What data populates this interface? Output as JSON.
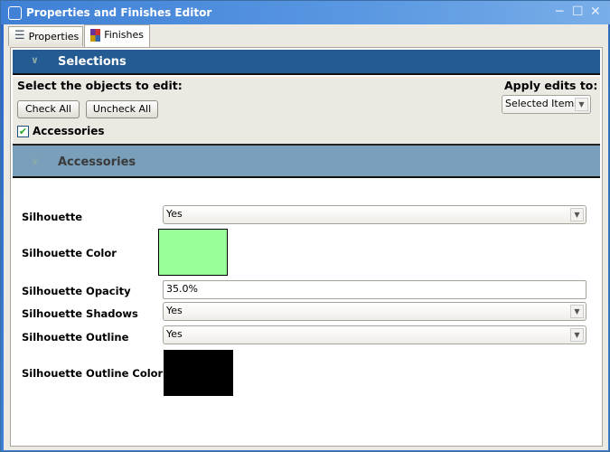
{
  "window": {
    "title": "Properties and Finishes Editor"
  },
  "tabs": [
    {
      "label": "Properties",
      "icon": "list-icon"
    },
    {
      "label": "Finishes",
      "icon": "color-grid-icon",
      "active": true
    }
  ],
  "selections": {
    "header": "Selections",
    "prompt": "Select the objects to edit:",
    "check_all": "Check All",
    "uncheck_all": "Uncheck All",
    "apply_label": "Apply edits to:",
    "apply_value": "Selected Items",
    "items": [
      {
        "label": "Accessories",
        "checked": true
      }
    ]
  },
  "accessories": {
    "header": "Accessories",
    "properties": {
      "silhouette": {
        "label": "Silhouette",
        "value": "Yes"
      },
      "silhouette_color": {
        "label": "Silhouette Color",
        "color": "#99ff99"
      },
      "silhouette_opacity": {
        "label": "Silhouette Opacity",
        "value": "35.0%"
      },
      "silhouette_shadows": {
        "label": "Silhouette Shadows",
        "value": "Yes"
      },
      "silhouette_outline": {
        "label": "Silhouette Outline",
        "value": "Yes"
      },
      "silhouette_outline_color": {
        "label": "Silhouette Outline Color",
        "color": "#000000"
      }
    }
  }
}
